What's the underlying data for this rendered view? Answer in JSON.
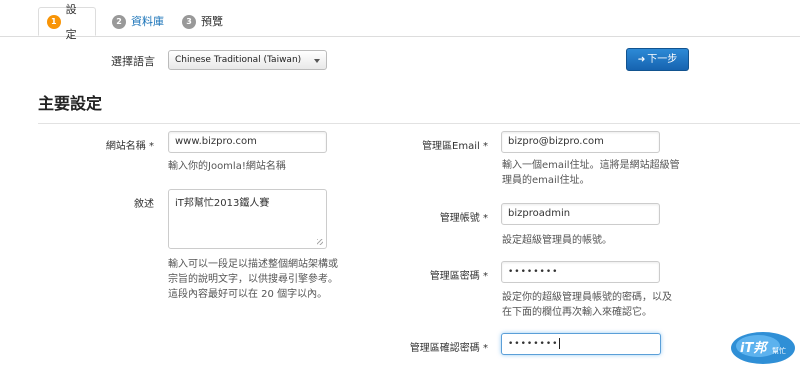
{
  "tabs": [
    {
      "num": "1",
      "label": "設定"
    },
    {
      "num": "2",
      "label": "資料庫"
    },
    {
      "num": "3",
      "label": "預覽"
    }
  ],
  "language": {
    "label": "選擇語言",
    "selected": "Chinese Traditional (Taiwan)"
  },
  "toolbar": {
    "next_label": "下一步"
  },
  "section_title": "主要設定",
  "left": {
    "site_name": {
      "label": "網站名稱 *",
      "value": "www.bizpro.com",
      "help": "輸入你的Joomla!網站名稱"
    },
    "description": {
      "label": "敘述",
      "value": "iT邦幫忙2013鐵人賽",
      "help": [
        "輸入可以一段足以描述整個網站架構或",
        "宗旨的說明文字，以供搜尋引擎參考。",
        "這段內容最好可以在 20 個字以內。"
      ]
    }
  },
  "right": {
    "admin_email": {
      "label": "管理區Email *",
      "value": "bizpro@bizpro.com",
      "help": [
        "輸入一個email住址。這將是網站超級管",
        "理員的email住址。"
      ]
    },
    "admin_user": {
      "label": "管理帳號 *",
      "value": "bizproadmin",
      "help": "設定超級管理員的帳號。"
    },
    "admin_password": {
      "label": "管理區密碼 *",
      "value": "••••••••",
      "help": [
        "設定你的超級管理員帳號的密碼，以及",
        "在下面的欄位再次輸入來確認它。"
      ]
    },
    "admin_password_confirm": {
      "label": "管理區確認密碼 *",
      "value": "••••••••"
    }
  },
  "watermark": {
    "text_main": "iT邦",
    "text_sub": "幫忙"
  },
  "colors": {
    "accent": "#1663b0",
    "active_num": "#f89406",
    "link": "#1a73b8"
  }
}
